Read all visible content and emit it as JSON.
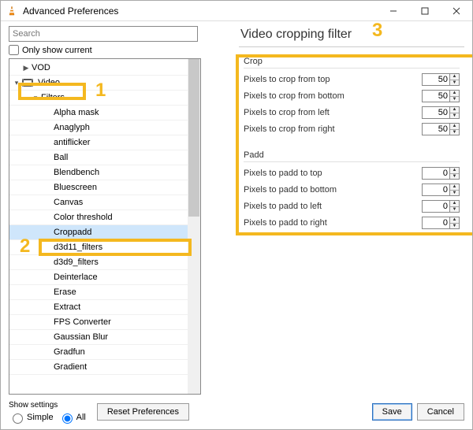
{
  "window": {
    "title": "Advanced Preferences"
  },
  "search": {
    "placeholder": "Search"
  },
  "only_show_current": "Only show current",
  "tree": {
    "vod": "VOD",
    "video": "Video",
    "filters": "Filters",
    "items": [
      "Alpha mask",
      "Anaglyph",
      "antiflicker",
      "Ball",
      "Blendbench",
      "Bluescreen",
      "Canvas",
      "Color threshold",
      "Croppadd",
      "d3d11_filters",
      "d3d9_filters",
      "Deinterlace",
      "Erase",
      "Extract",
      "FPS Converter",
      "Gaussian Blur",
      "Gradfun",
      "Gradient"
    ]
  },
  "right": {
    "title": "Video cropping filter",
    "crop": {
      "head": "Crop",
      "rows": [
        {
          "label": "Pixels to crop from top",
          "value": 50
        },
        {
          "label": "Pixels to crop from bottom",
          "value": 50
        },
        {
          "label": "Pixels to crop from left",
          "value": 50
        },
        {
          "label": "Pixels to crop from right",
          "value": 50
        }
      ]
    },
    "padd": {
      "head": "Padd",
      "rows": [
        {
          "label": "Pixels to padd to top",
          "value": 0
        },
        {
          "label": "Pixels to padd to bottom",
          "value": 0
        },
        {
          "label": "Pixels to padd to left",
          "value": 0
        },
        {
          "label": "Pixels to padd to right",
          "value": 0
        }
      ]
    }
  },
  "footer": {
    "show_settings": "Show settings",
    "simple": "Simple",
    "all": "All",
    "reset": "Reset Preferences",
    "save": "Save",
    "cancel": "Cancel"
  },
  "annotations": {
    "one": "1",
    "two": "2",
    "three": "3"
  }
}
